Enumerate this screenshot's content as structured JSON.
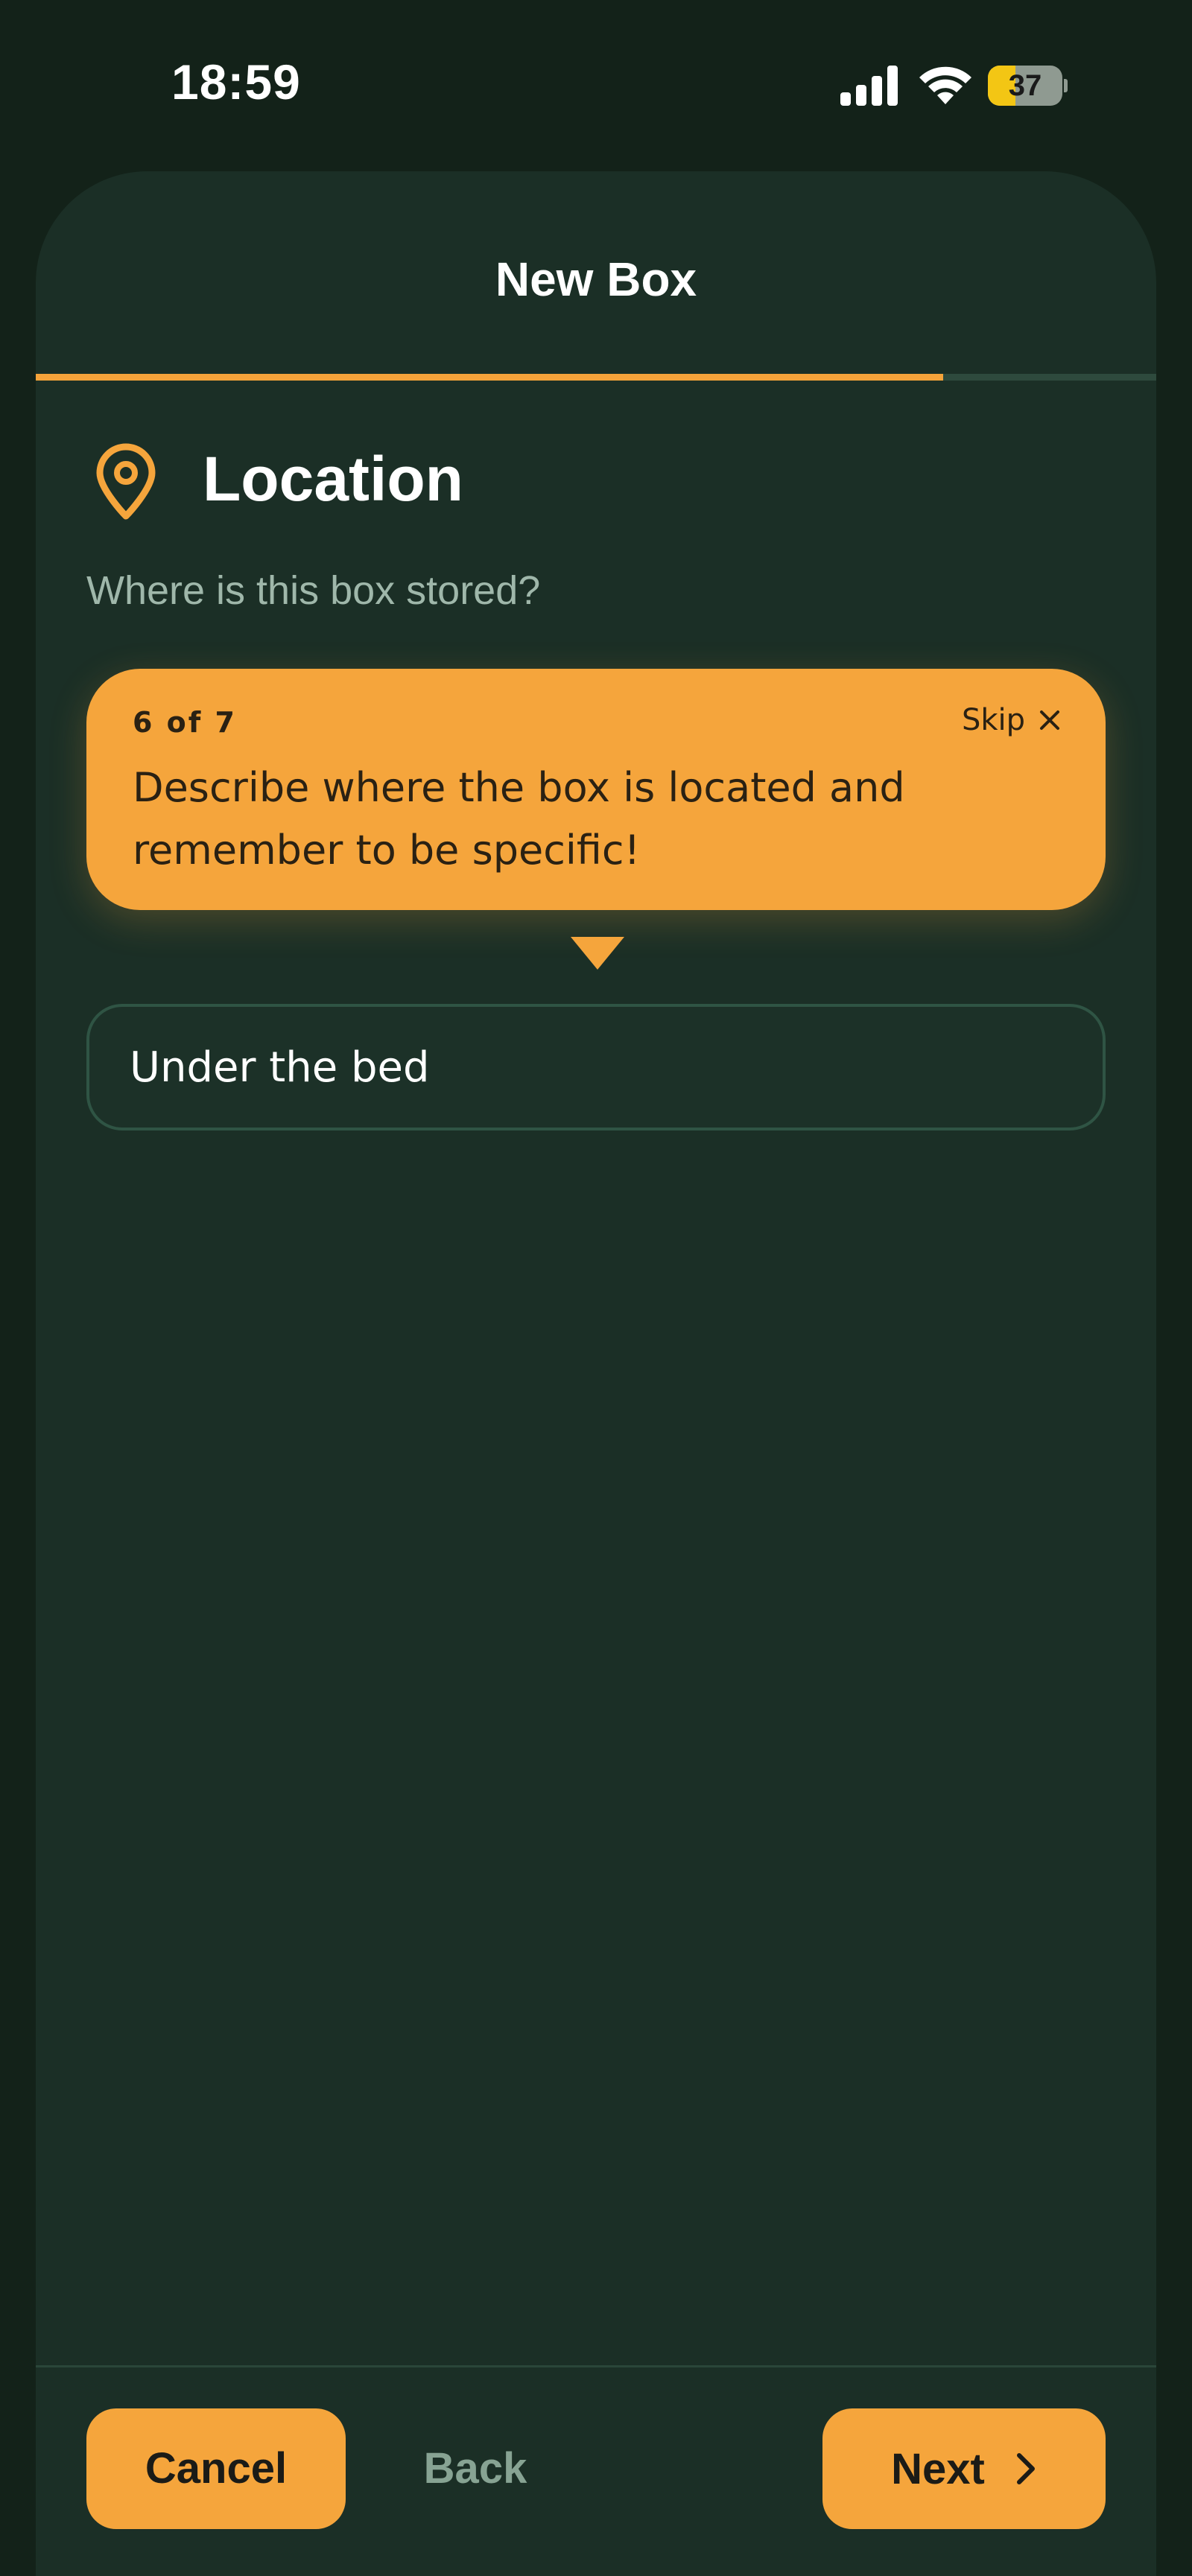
{
  "status_bar": {
    "time": "18:59",
    "battery_level": "37",
    "battery_fraction": 0.37,
    "icons": [
      "signal-icon",
      "wifi-icon",
      "battery-icon"
    ]
  },
  "sheet": {
    "title": "New Box",
    "progress_fraction": 0.81
  },
  "section": {
    "icon": "location-pin-icon",
    "title": "Location",
    "subtitle": "Where is this box stored?"
  },
  "tooltip": {
    "step": "6 of 7",
    "skip_label": "Skip",
    "message": "Describe where the box is located and remember to be specific!"
  },
  "location_field": {
    "value": "Under the bed"
  },
  "footer": {
    "cancel_label": "Cancel",
    "back_label": "Back",
    "next_label": "Next"
  },
  "colors": {
    "accent": "#f5a53c",
    "background": "#132219",
    "sheet": "#1b2f26",
    "subtle_text": "#9fb7aa"
  }
}
